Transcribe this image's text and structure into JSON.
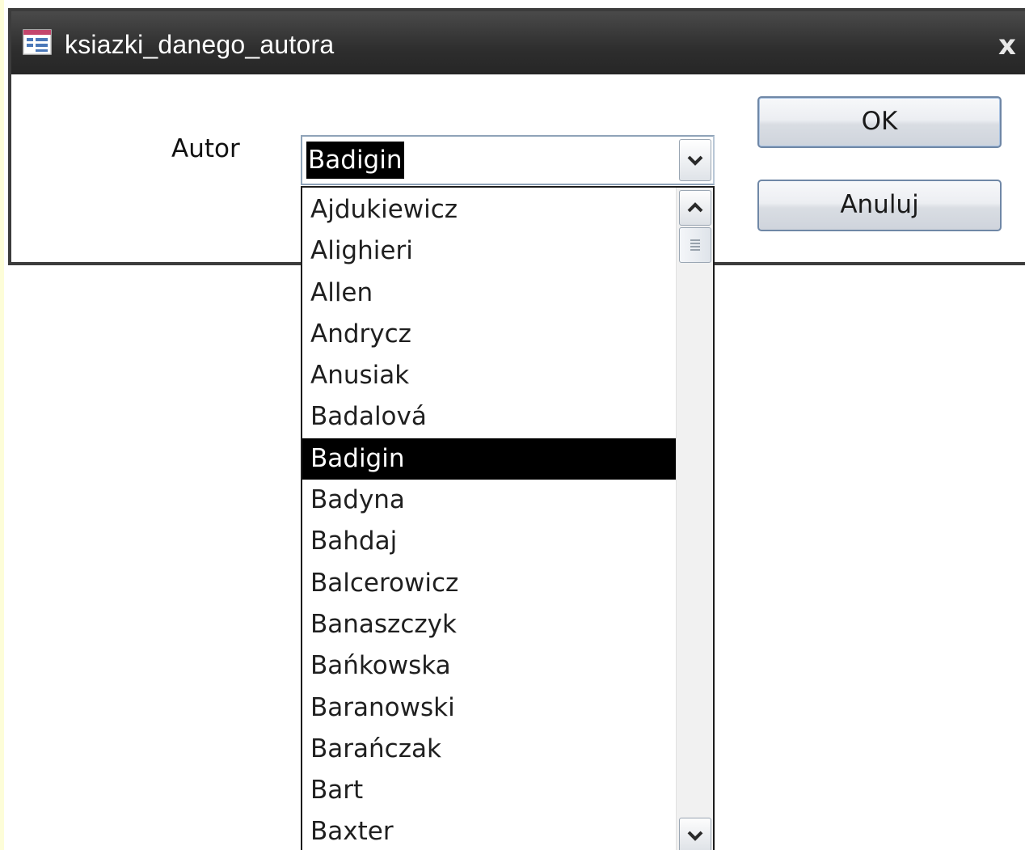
{
  "window": {
    "title": "ksiazki_danego_autora",
    "icon": "form-icon",
    "close_label": "x"
  },
  "form": {
    "autor_label": "Autor",
    "autor_value": "Badigin"
  },
  "buttons": {
    "ok_label": "OK",
    "cancel_label": "Anuluj"
  },
  "dropdown": {
    "selected": "Badigin",
    "items": [
      "Ajdukiewicz",
      "Alighieri",
      "Allen",
      "Andrycz",
      "Anusiak",
      "Badalová",
      "Badigin",
      "Badyna",
      "Bahdaj",
      "Balcerowicz",
      "Banaszczyk",
      "Bańkowska",
      "Baranowski",
      "Barańczak",
      "Bart",
      "Baxter"
    ]
  },
  "colors": {
    "titlebar": "#2e2e2e",
    "selection": "#000000",
    "button_border": "#6f87a6"
  }
}
